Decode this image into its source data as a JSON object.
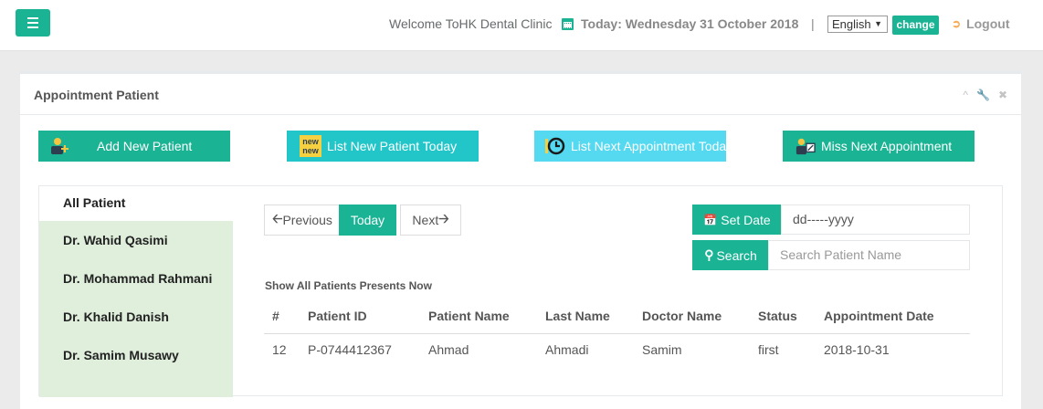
{
  "header": {
    "welcome": "Welcome ToHK Dental Clinic",
    "today": "Today: Wednesday 31 October 2018",
    "separator": "|",
    "language": "English",
    "change_label": "change",
    "logout_label": "Logout"
  },
  "panel": {
    "title": "Appointment Patient"
  },
  "actions": {
    "add_new": "Add New Patient",
    "list_new_today": "List New Patient Today",
    "list_next_appointment": "List Next Appointment Toda",
    "miss_next": "Miss Next Appointment",
    "new_badge_top": "new",
    "new_badge_bottom": "new"
  },
  "doctors": [
    "All Patient",
    "Dr.  Wahid Qasimi",
    "Dr.  Mohammad Rahmani",
    "Dr.  Khalid Danish",
    "Dr.  Samim Musawy"
  ],
  "nav": {
    "previous": "Previous",
    "today": "Today",
    "next": "Next"
  },
  "date_filter": {
    "set_date_label": "Set Date",
    "date_value": "dd-----yyyy"
  },
  "search": {
    "button": "Search",
    "placeholder": "Search Patient Name"
  },
  "section_label": "Show All Patients Presents Now",
  "table": {
    "columns": [
      "#",
      "Patient ID",
      "Patient Name",
      "Last Name",
      "Doctor Name",
      "Status",
      "Appointment Date"
    ],
    "rows": [
      [
        "12",
        "P-0744412367",
        "Ahmad",
        "Ahmadi",
        "Samim",
        "first",
        "2018-10-31"
      ]
    ]
  },
  "colors": {
    "primary": "#1ab394",
    "teal": "#23c6c8",
    "cyan": "#54d9f0",
    "doctor_bg": "#dfefdc",
    "logout_icon": "#f8ac59"
  }
}
